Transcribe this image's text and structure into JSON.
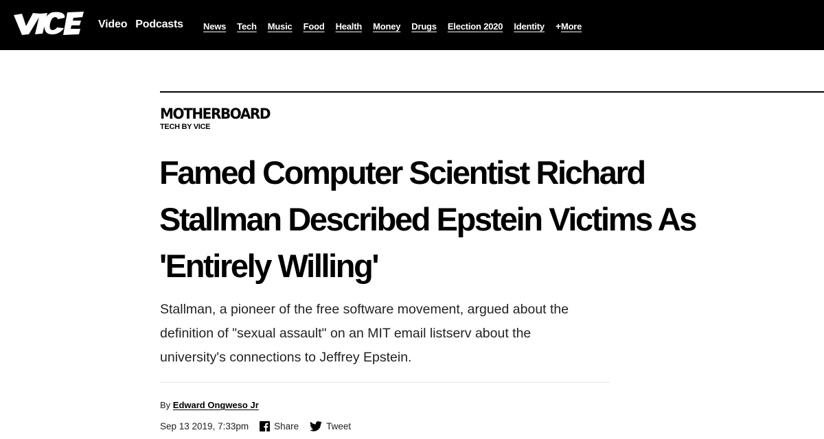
{
  "site": {
    "logo_text": "VICE",
    "primary_nav": [
      "Video",
      "Podcasts"
    ],
    "secondary_nav": [
      "News",
      "Tech",
      "Music",
      "Food",
      "Health",
      "Money",
      "Drugs",
      "Election 2020",
      "Identity"
    ],
    "more_plus": "+",
    "more_label": "More"
  },
  "article": {
    "section_name": "MOTHERBOARD",
    "section_sub": "TECH BY VICE",
    "headline_line1": "Famed Computer Scientist Richard",
    "headline_line2": "Stallman Described Epstein Victims As",
    "headline_line3": "'Entirely Willing'",
    "dek_line1": "Stallman, a pioneer of the free software movement, argued about the",
    "dek_line2": "definition of \"sexual assault\" on an MIT email listserv about the",
    "dek_line3": "university's connections to Jeffrey Epstein.",
    "by_label": "By",
    "author": "Edward Ongweso Jr",
    "date": "Sep 13 2019, 7:33pm",
    "share_label": "Share",
    "tweet_label": "Tweet"
  },
  "icons": {
    "share": "facebook-icon",
    "tweet": "twitter-icon"
  }
}
